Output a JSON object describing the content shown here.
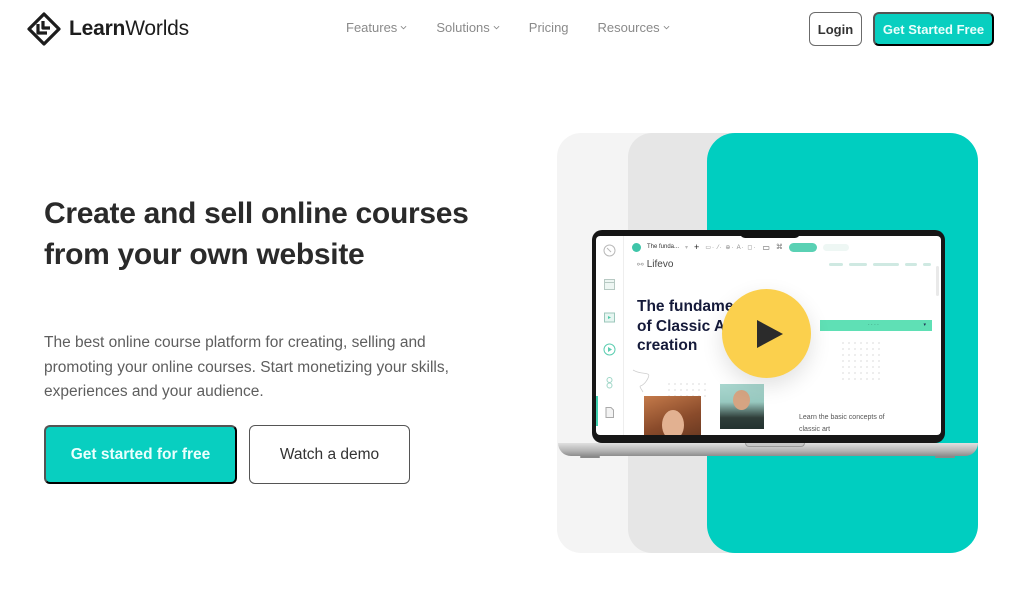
{
  "header": {
    "brand": {
      "bold": "Learn",
      "light": "Worlds"
    },
    "nav": [
      {
        "label": "Features",
        "has_dropdown": true
      },
      {
        "label": "Solutions",
        "has_dropdown": true
      },
      {
        "label": "Pricing",
        "has_dropdown": false
      },
      {
        "label": "Resources",
        "has_dropdown": true
      }
    ],
    "login_label": "Login",
    "cta_label": "Get Started Free"
  },
  "hero": {
    "title": "Create and sell online courses from your own website",
    "subtitle": "The best online course platform for creating, selling and promoting your online courses. Start monetizing your skills, experiences and your audience.",
    "primary_label": "Get started for free",
    "secondary_label": "Watch a demo"
  },
  "preview": {
    "tab_name": "The funda...",
    "site_brand": "Lifevo",
    "heading": "The fundamentals of Classic Art creation",
    "description": "Learn the basic concepts of classic art",
    "play_icon": "play-icon"
  },
  "colors": {
    "accent": "#08cfc0",
    "panel_teal": "#00cec0",
    "play_button": "#fbd04d",
    "text_dark": "#2a2a2a"
  }
}
